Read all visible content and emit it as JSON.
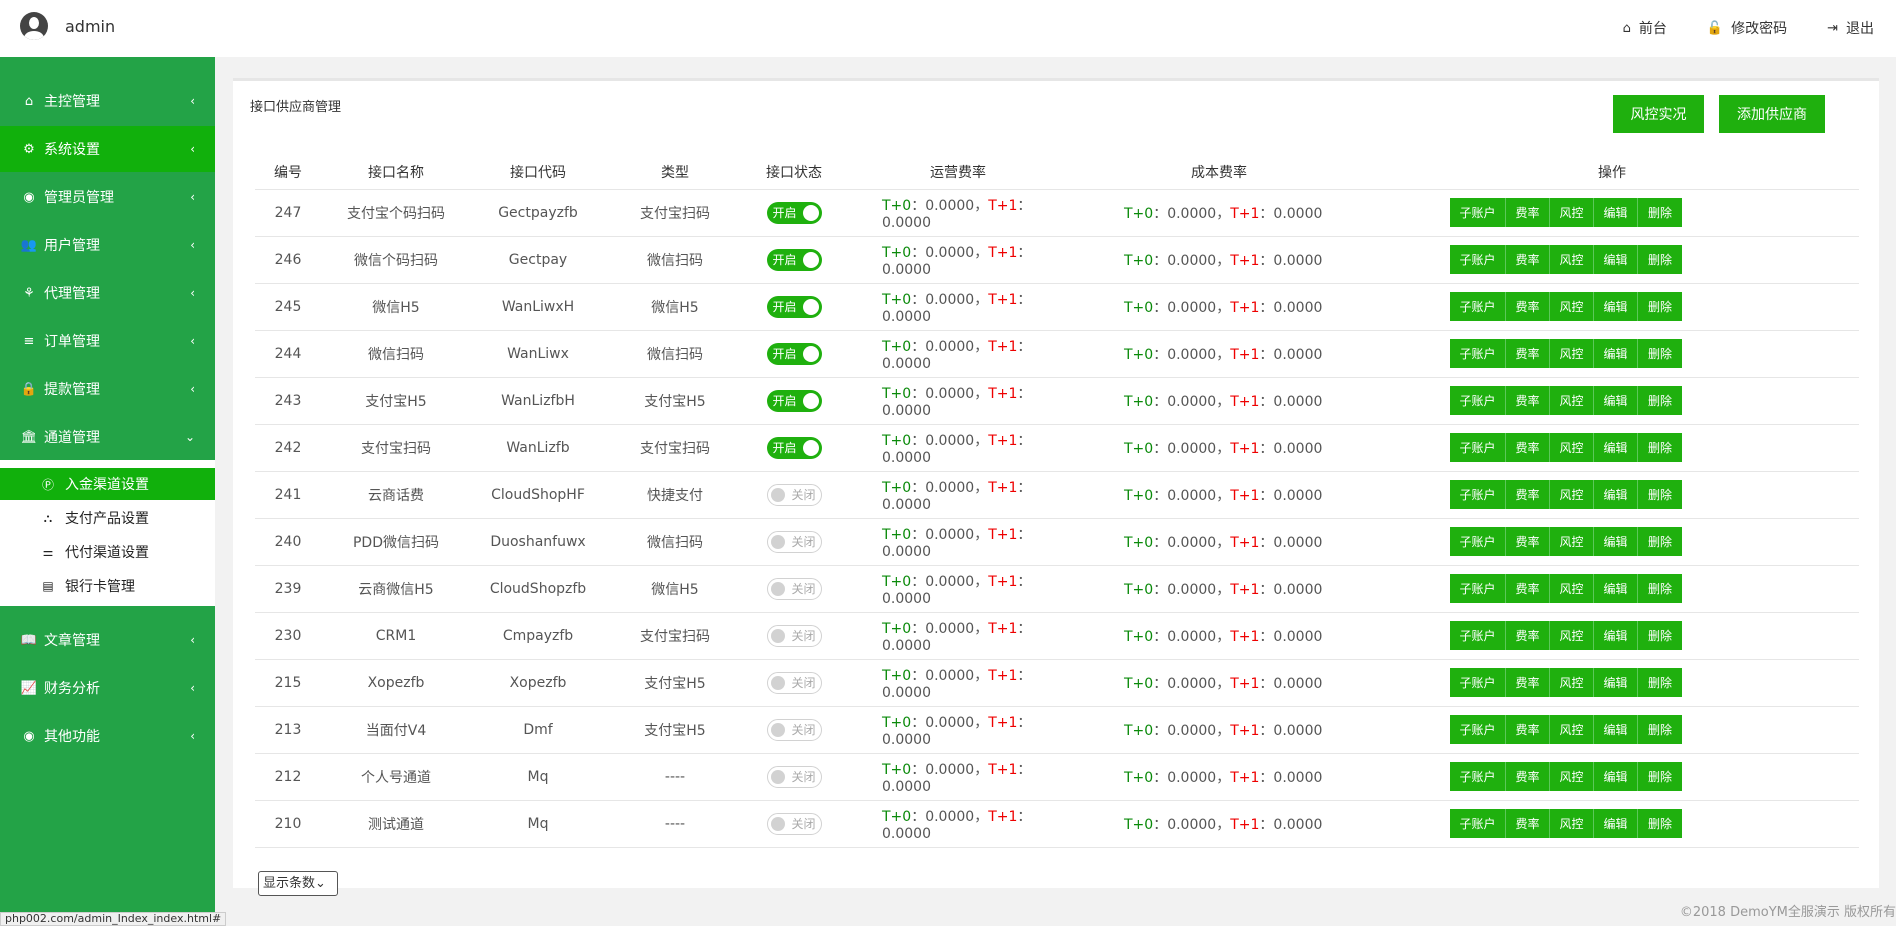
{
  "header": {
    "username": "admin",
    "links": [
      {
        "icon": "home-icon",
        "glyph": "⌂",
        "label": "前台"
      },
      {
        "icon": "lock-icon",
        "glyph": "🔓",
        "label": "修改密码"
      },
      {
        "icon": "sign-out-icon",
        "glyph": "⇥",
        "label": "退出"
      }
    ]
  },
  "sidebar": {
    "items": [
      {
        "icon": "home-icon",
        "glyph": "⌂",
        "label": "主控管理",
        "chevron": "‹"
      },
      {
        "icon": "gears-icon",
        "glyph": "⚙",
        "label": "系统设置",
        "chevron": "‹"
      },
      {
        "icon": "user-circle-icon",
        "glyph": "◉",
        "label": "管理员管理",
        "chevron": "‹"
      },
      {
        "icon": "users-icon",
        "glyph": "👥",
        "label": "用户管理",
        "chevron": "‹"
      },
      {
        "icon": "handshake-icon",
        "glyph": "⚘",
        "label": "代理管理",
        "chevron": "‹"
      },
      {
        "icon": "list-icon",
        "glyph": "≡",
        "label": "订单管理",
        "chevron": "‹"
      },
      {
        "icon": "lock-icon",
        "glyph": "🔒",
        "label": "提款管理",
        "chevron": "‹"
      },
      {
        "icon": "bank-icon",
        "glyph": "🏛",
        "label": "通道管理",
        "chevron": "⌄"
      },
      {
        "icon": "book-icon",
        "glyph": "📖",
        "label": "文章管理",
        "chevron": "‹"
      },
      {
        "icon": "line-chart-icon",
        "glyph": "📈",
        "label": "财务分析",
        "chevron": "‹"
      },
      {
        "icon": "user-circle-icon",
        "glyph": "◉",
        "label": "其他功能",
        "chevron": "‹"
      }
    ],
    "subitems": [
      {
        "icon": "product-hunt-icon",
        "glyph": "Ⓟ",
        "label": "入金渠道设置"
      },
      {
        "icon": "sitemap-icon",
        "glyph": "⛬",
        "label": "支付产品设置"
      },
      {
        "icon": "sliders-icon",
        "glyph": "⚌",
        "label": "代付渠道设置"
      },
      {
        "icon": "credit-card-icon",
        "glyph": "▤",
        "label": "银行卡管理"
      }
    ]
  },
  "panel": {
    "title": "接口供应商管理",
    "buttons": {
      "risk": "风控实况",
      "add": "添加供应商"
    }
  },
  "table": {
    "headers": [
      "编号",
      "接口名称",
      "接口代码",
      "类型",
      "接口状态",
      "运营费率",
      "成本费率",
      "操作"
    ],
    "switch_on": "开启",
    "switch_off": "关闭",
    "rate_labels": {
      "t0": "T+0",
      "t1": "T+1",
      "colon": "：",
      "sep": "，"
    },
    "ops": [
      "子账户",
      "费率",
      "风控",
      "编辑",
      "删除"
    ],
    "rows": [
      {
        "id": "247",
        "name": "支付宝个码扫码",
        "code": "Gectpayzfb",
        "type": "支付宝扫码",
        "on": true,
        "op_t0": "0.0000",
        "op_t1": "0.0000",
        "cost_t0": "0.0000",
        "cost_t1": "0.0000"
      },
      {
        "id": "246",
        "name": "微信个码扫码",
        "code": "Gectpay",
        "type": "微信扫码",
        "on": true,
        "op_t0": "0.0000",
        "op_t1": "0.0000",
        "cost_t0": "0.0000",
        "cost_t1": "0.0000"
      },
      {
        "id": "245",
        "name": "微信H5",
        "code": "WanLiwxH",
        "type": "微信H5",
        "on": true,
        "op_t0": "0.0000",
        "op_t1": "0.0000",
        "cost_t0": "0.0000",
        "cost_t1": "0.0000"
      },
      {
        "id": "244",
        "name": "微信扫码",
        "code": "WanLiwx",
        "type": "微信扫码",
        "on": true,
        "op_t0": "0.0000",
        "op_t1": "0.0000",
        "cost_t0": "0.0000",
        "cost_t1": "0.0000"
      },
      {
        "id": "243",
        "name": "支付宝H5",
        "code": "WanLizfbH",
        "type": "支付宝H5",
        "on": true,
        "op_t0": "0.0000",
        "op_t1": "0.0000",
        "cost_t0": "0.0000",
        "cost_t1": "0.0000"
      },
      {
        "id": "242",
        "name": "支付宝扫码",
        "code": "WanLizfb",
        "type": "支付宝扫码",
        "on": true,
        "op_t0": "0.0000",
        "op_t1": "0.0000",
        "cost_t0": "0.0000",
        "cost_t1": "0.0000"
      },
      {
        "id": "241",
        "name": "云商话费",
        "code": "CloudShopHF",
        "type": "快捷支付",
        "on": false,
        "op_t0": "0.0000",
        "op_t1": "0.0000",
        "cost_t0": "0.0000",
        "cost_t1": "0.0000"
      },
      {
        "id": "240",
        "name": "PDD微信扫码",
        "code": "Duoshanfuwx",
        "type": "微信扫码",
        "on": false,
        "op_t0": "0.0000",
        "op_t1": "0.0000",
        "cost_t0": "0.0000",
        "cost_t1": "0.0000"
      },
      {
        "id": "239",
        "name": "云商微信H5",
        "code": "CloudShopzfb",
        "type": "微信H5",
        "on": false,
        "op_t0": "0.0000",
        "op_t1": "0.0000",
        "cost_t0": "0.0000",
        "cost_t1": "0.0000"
      },
      {
        "id": "230",
        "name": "CRM1",
        "code": "Cmpayzfb",
        "type": "支付宝扫码",
        "on": false,
        "op_t0": "0.0000",
        "op_t1": "0.0000",
        "cost_t0": "0.0000",
        "cost_t1": "0.0000"
      },
      {
        "id": "215",
        "name": "Xopezfb",
        "code": "Xopezfb",
        "type": "支付宝H5",
        "on": false,
        "op_t0": "0.0000",
        "op_t1": "0.0000",
        "cost_t0": "0.0000",
        "cost_t1": "0.0000"
      },
      {
        "id": "213",
        "name": "当面付V4",
        "code": "Dmf",
        "type": "支付宝H5",
        "on": false,
        "op_t0": "0.0000",
        "op_t1": "0.0000",
        "cost_t0": "0.0000",
        "cost_t1": "0.0000"
      },
      {
        "id": "212",
        "name": "个人号通道",
        "code": "Mq",
        "type": "----",
        "on": false,
        "op_t0": "0.0000",
        "op_t1": "0.0000",
        "cost_t0": "0.0000",
        "cost_t1": "0.0000"
      },
      {
        "id": "210",
        "name": "测试通道",
        "code": "Mq",
        "type": "----",
        "on": false,
        "op_t0": "0.0000",
        "op_t1": "0.0000",
        "cost_t0": "0.0000",
        "cost_t1": "0.0000"
      }
    ]
  },
  "page_size": {
    "label": "显示条数",
    "arrow": "⌄"
  },
  "footer": "©2018 DemoYM全服演示 版权所有",
  "statusbar": "php002.com/admin_Index_index.html#"
}
